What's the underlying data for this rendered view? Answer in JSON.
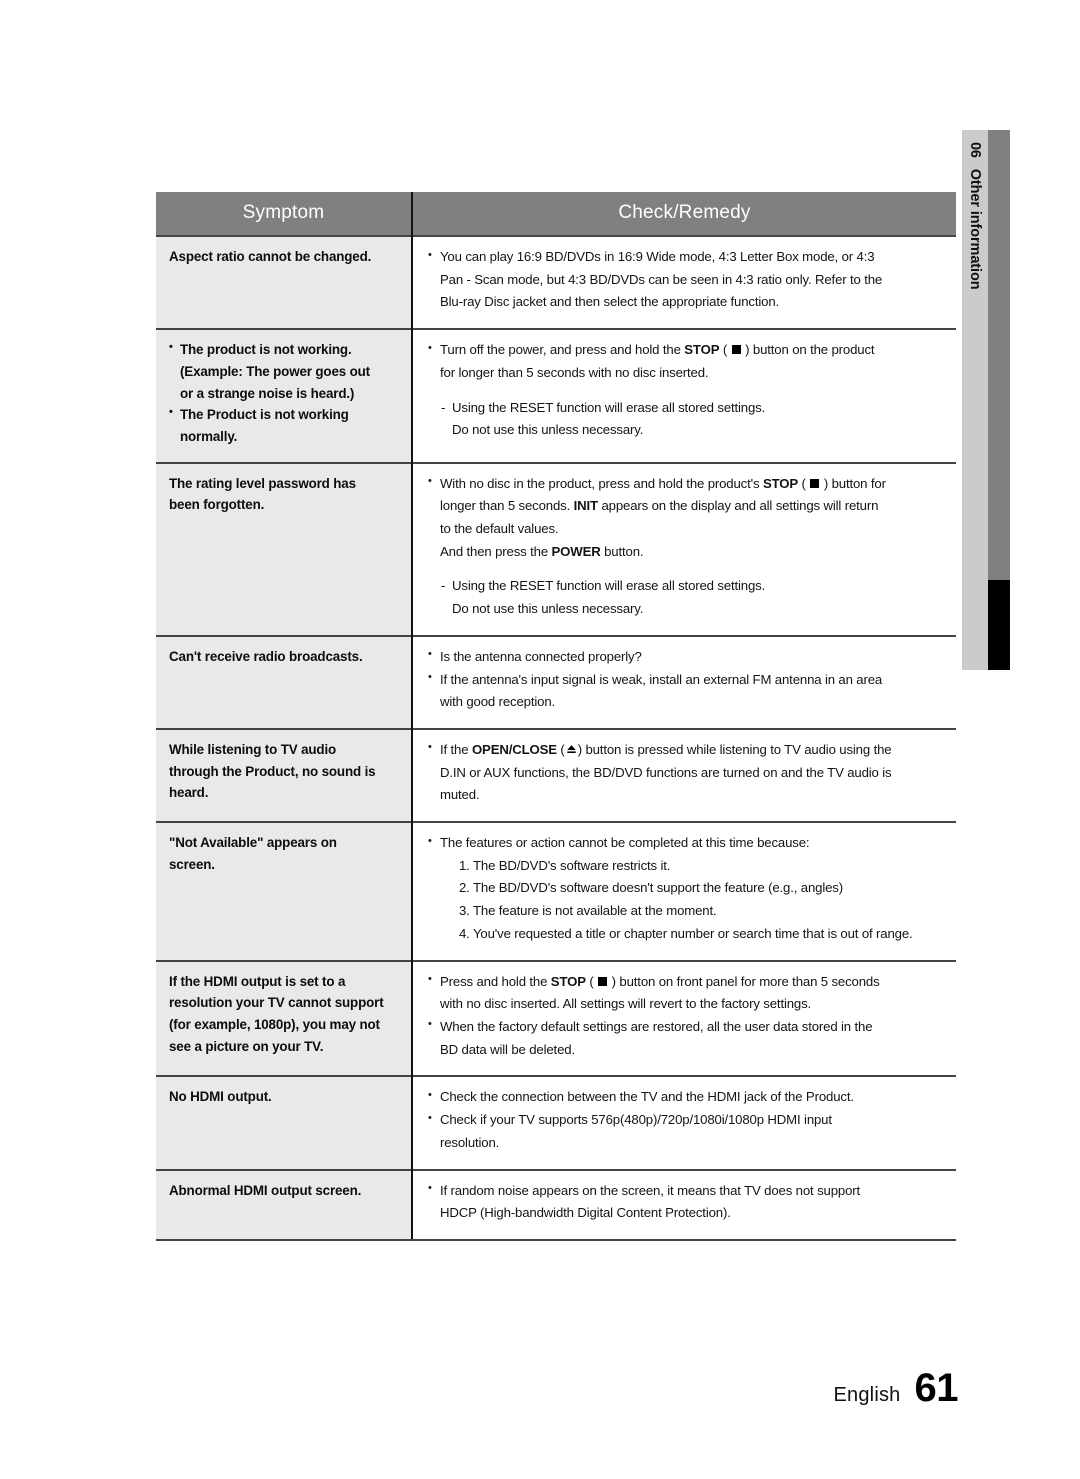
{
  "chapter_tab": {
    "number": "06",
    "name": "Other information"
  },
  "table": {
    "headers": {
      "symptom": "Symptom",
      "remedy": "Check/Remedy"
    },
    "rows": [
      {
        "symptom": {
          "lines": [
            "Aspect ratio cannot be changed."
          ],
          "style": "plain"
        },
        "remedy": {
          "bullet1": "You can play 16:9 BD/DVDs in 16:9 Wide mode, 4:3 Letter Box mode, or 4:3",
          "bullet1_c1": "Pan - Scan mode, but 4:3 BD/DVDs can be seen in 4:3 ratio only. Refer to the",
          "bullet1_c2": "Blu-ray Disc jacket and then select the appropriate function."
        }
      },
      {
        "symptom": {
          "b1": "The product is not working.",
          "b1_c1": "(Example: The power goes out",
          "b1_c2": "or a strange noise is heard.)",
          "b2": "The Product is not working",
          "b2_c1": "normally."
        },
        "remedy": {
          "bullet1_a": "Turn off the power, and press and hold the ",
          "bullet1_stop": "STOP",
          "bullet1_b": " ( ",
          "bullet1_c": " ) button on the product",
          "bullet1_cont": "for longer than 5 seconds with no disc inserted.",
          "dash1": "Using the RESET function will erase all stored settings.",
          "dash1_cont": "Do not use this unless necessary."
        }
      },
      {
        "symptom": {
          "l1": "The rating level password has",
          "l2": "been forgotten."
        },
        "remedy": {
          "b1_a": "With no disc in the product, press and hold the product's ",
          "b1_stop": "STOP",
          "b1_b": " ( ",
          "b1_c": " ) button for",
          "b1_cont1_a": "longer than 5 seconds. ",
          "b1_cont1_init": "INIT",
          "b1_cont1_b": " appears on the display and all settings will return",
          "b1_cont2": "to the default values.",
          "b1_cont3_a": "And then press the ",
          "b1_cont3_power": "POWER",
          "b1_cont3_b": " button.",
          "dash1": "Using the RESET function will erase all stored settings.",
          "dash1_cont": "Do not use this unless necessary."
        }
      },
      {
        "symptom": {
          "l1": "Can't receive radio broadcasts."
        },
        "remedy": {
          "b1": "Is the antenna connected properly?",
          "b2": "If the antenna's input signal is weak, install an external FM antenna in an area",
          "b2_cont": "with good reception."
        }
      },
      {
        "symptom": {
          "l1": "While listening to TV audio",
          "l2": "through the Product, no sound is",
          "l3": "heard."
        },
        "remedy": {
          "b1_a": "If the ",
          "b1_openclose": "OPEN/CLOSE",
          "b1_b": " (",
          "b1_c": ") button is pressed while listening to TV audio using the",
          "b1_cont1": "D.IN or AUX functions, the BD/DVD functions are turned on and the TV audio is",
          "b1_cont2": "muted."
        }
      },
      {
        "symptom": {
          "l1": "\"Not Available\" appears on",
          "l2": "screen."
        },
        "remedy": {
          "b1": "The features or action cannot be completed at this time because:",
          "n1": "1. The BD/DVD's software restricts it.",
          "n2": "2. The BD/DVD's software doesn't support the feature (e.g., angles)",
          "n3": "3. The feature is not available at the moment.",
          "n4": "4. You've requested a title or chapter number or search time that is out of range."
        }
      },
      {
        "symptom": {
          "l1": "If the HDMI output is set to a",
          "l2": "resolution your TV cannot support",
          "l3": "(for example, 1080p), you may not",
          "l4": "see a picture on your TV."
        },
        "remedy": {
          "b1_a": "Press and hold the ",
          "b1_stop": "STOP",
          "b1_b": " ( ",
          "b1_c": " ) button on front panel for more than 5 seconds",
          "b1_cont": "with no disc inserted. All settings will revert to the factory settings.",
          "b2": "When the factory default settings are restored, all the user data stored in the",
          "b2_cont": "BD data will be deleted."
        }
      },
      {
        "symptom": {
          "l1": "No HDMI output."
        },
        "remedy": {
          "b1": "Check the connection between the TV and the HDMI jack of the Product.",
          "b2": "Check if your TV supports 576p(480p)/720p/1080i/1080p HDMI input",
          "b2_cont": "resolution."
        }
      },
      {
        "symptom": {
          "l1": "Abnormal HDMI output screen."
        },
        "remedy": {
          "b1": "If random noise appears on the screen, it means that TV does not support",
          "b1_cont": "HDCP (High-bandwidth Digital Content Protection)."
        }
      }
    ]
  },
  "footer": {
    "language": "English",
    "page_number": "61"
  },
  "colors": {
    "header_bg": "#808080",
    "symptom_bg": "#e9e9e9",
    "tab_bg": "#cbcbcb",
    "tab_band": "#808080",
    "tab_band_accent": "#000000"
  }
}
